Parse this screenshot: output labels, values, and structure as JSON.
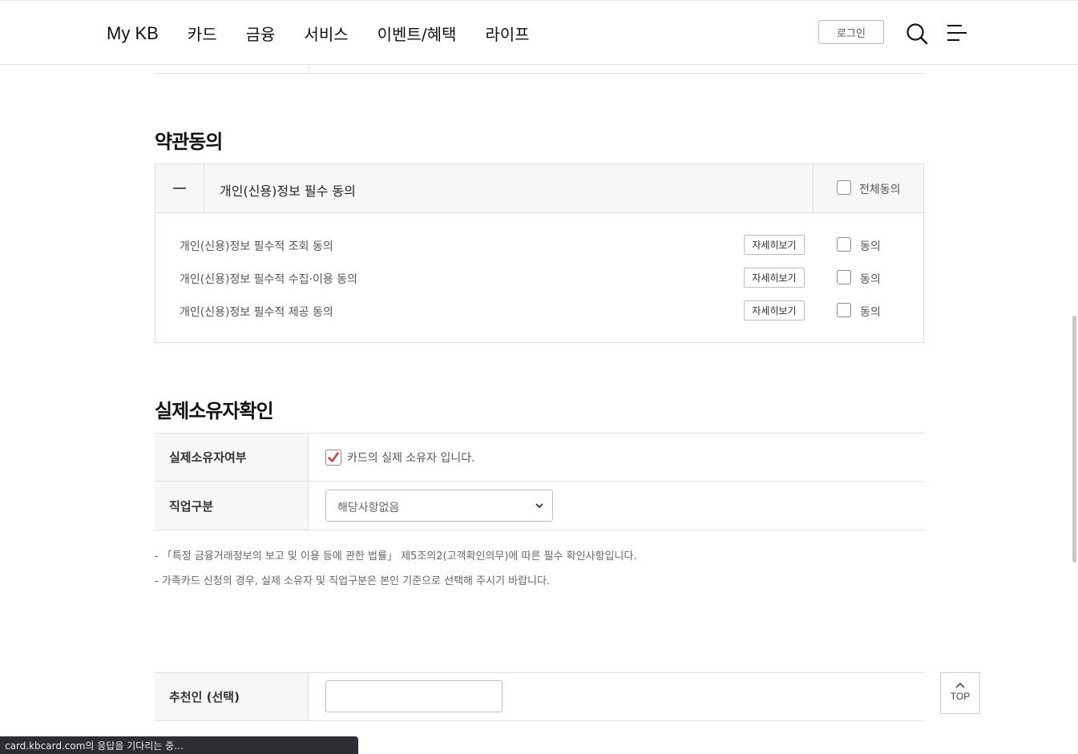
{
  "header": {
    "nav": [
      "My KB",
      "카드",
      "금융",
      "서비스",
      "이벤트/혜택",
      "라이프"
    ],
    "login_label": "로그인"
  },
  "terms": {
    "title": "약관동의",
    "group_title": "개인(신용)정보 필수 동의",
    "all_agree_label": "전체동의",
    "items": [
      {
        "text": "개인(신용)정보 필수적 조회 동의",
        "detail_label": "자세히보기",
        "agree_label": "동의"
      },
      {
        "text": "개인(신용)정보 필수적 수집·이용 동의",
        "detail_label": "자세히보기",
        "agree_label": "동의"
      },
      {
        "text": "개인(신용)정보 필수적 제공 동의",
        "detail_label": "자세히보기",
        "agree_label": "동의"
      }
    ]
  },
  "owner": {
    "title": "실제소유자확인",
    "owner_row_label": "실제소유자여부",
    "owner_check_label": "카드의 실제 소유자 입니다.",
    "owner_checked": true,
    "job_row_label": "직업구분",
    "job_selected": "해당사항없음",
    "notes": [
      "- 「특정 금융거래정보의 보고 및 이용 등에 관한 법률」 제5조의2(고객확인의무)에 따른 필수 확인사항입니다.",
      "- 가족카드 신청의 경우, 실제 소유자 및 직업구분은 본인 기준으로 선택해 주시기 바랍니다."
    ]
  },
  "recommender": {
    "label": "추천인 (선택)",
    "value": ""
  },
  "top_button_label": "TOP",
  "status_text": "card.kbcard.com의 응답을 기다리는 중...",
  "colors": {
    "check_mark": "#e0393e",
    "header_bg": "#f7f7f7"
  }
}
